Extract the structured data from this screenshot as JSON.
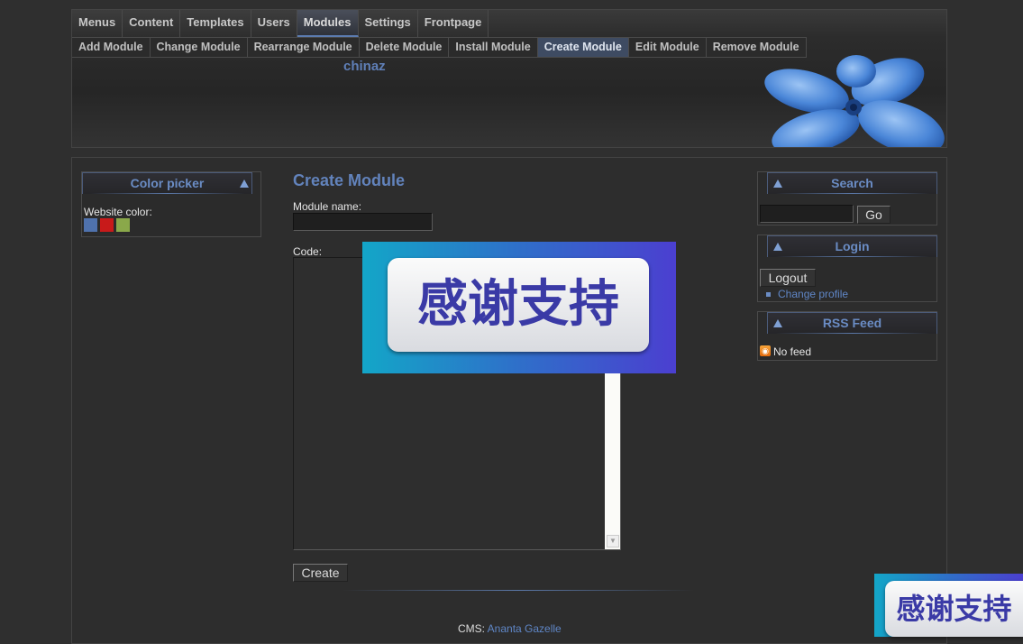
{
  "nav": {
    "top": [
      "Menus",
      "Content",
      "Templates",
      "Users",
      "Modules",
      "Settings",
      "Frontpage"
    ],
    "top_active": "Modules",
    "sub": [
      "Add Module",
      "Change Module",
      "Rearrange Module",
      "Delete Module",
      "Install Module",
      "Create Module",
      "Edit Module",
      "Remove Module"
    ],
    "sub_active": "Create Module"
  },
  "site": {
    "title": "chinaz"
  },
  "color_picker": {
    "title": "Color picker",
    "label": "Website color:",
    "swatches": [
      "#4f72ad",
      "#c81a1a",
      "#8aa84a"
    ]
  },
  "content": {
    "heading": "Create Module",
    "name_label": "Module name:",
    "name_value": "",
    "code_label": "Code:",
    "code_value": "",
    "create_label": "Create"
  },
  "search": {
    "title": "Search",
    "value": "",
    "go_label": "Go"
  },
  "login": {
    "title": "Login",
    "logout_label": "Logout",
    "change_profile": "Change profile"
  },
  "rss": {
    "title": "RSS Feed",
    "no_feed": "No feed"
  },
  "footer": {
    "prefix": "CMS:",
    "link": "Ananta Gazelle"
  },
  "ads": {
    "text": "感谢支持"
  },
  "colors": {
    "accent": "#6283bc",
    "background": "#2f2f2f"
  }
}
